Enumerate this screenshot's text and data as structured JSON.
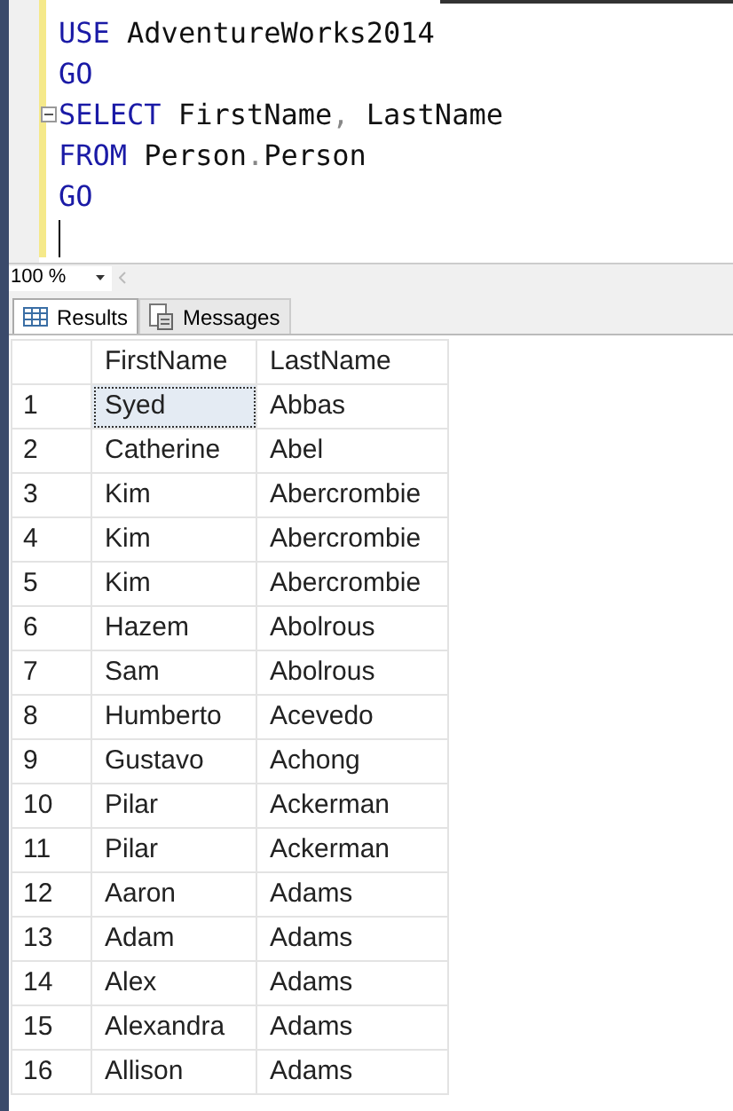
{
  "editor": {
    "lines": [
      {
        "tokens": [
          {
            "text": "USE",
            "kind": "keyword"
          },
          {
            "text": " AdventureWorks2014",
            "kind": "plain"
          }
        ]
      },
      {
        "tokens": [
          {
            "text": "GO",
            "kind": "keyword"
          }
        ]
      },
      {
        "collapsible": true,
        "tokens": [
          {
            "text": "SELECT",
            "kind": "keyword"
          },
          {
            "text": " FirstName",
            "kind": "plain"
          },
          {
            "text": ",",
            "kind": "punct"
          },
          {
            "text": " LastName",
            "kind": "plain"
          }
        ]
      },
      {
        "tokens": [
          {
            "text": "FROM",
            "kind": "keyword"
          },
          {
            "text": " Person",
            "kind": "plain"
          },
          {
            "text": ".",
            "kind": "punct"
          },
          {
            "text": "Person",
            "kind": "plain"
          }
        ]
      },
      {
        "tokens": [
          {
            "text": "GO",
            "kind": "keyword"
          }
        ]
      }
    ]
  },
  "zoom": {
    "value": "100 %"
  },
  "tabs": [
    {
      "label": "Results",
      "selected": true,
      "kind": "grid"
    },
    {
      "label": "Messages",
      "selected": false,
      "kind": "messages"
    }
  ],
  "table": {
    "columns": [
      "FirstName",
      "LastName"
    ],
    "rows": [
      {
        "n": "1",
        "cells": [
          "Syed",
          "Abbas"
        ],
        "selected": true
      },
      {
        "n": "2",
        "cells": [
          "Catherine",
          "Abel"
        ],
        "selected": false
      },
      {
        "n": "3",
        "cells": [
          "Kim",
          "Abercrombie"
        ],
        "selected": false
      },
      {
        "n": "4",
        "cells": [
          "Kim",
          "Abercrombie"
        ],
        "selected": false
      },
      {
        "n": "5",
        "cells": [
          "Kim",
          "Abercrombie"
        ],
        "selected": false
      },
      {
        "n": "6",
        "cells": [
          "Hazem",
          "Abolrous"
        ],
        "selected": false
      },
      {
        "n": "7",
        "cells": [
          "Sam",
          "Abolrous"
        ],
        "selected": false
      },
      {
        "n": "8",
        "cells": [
          "Humberto",
          "Acevedo"
        ],
        "selected": false
      },
      {
        "n": "9",
        "cells": [
          "Gustavo",
          "Achong"
        ],
        "selected": false
      },
      {
        "n": "10",
        "cells": [
          "Pilar",
          "Ackerman"
        ],
        "selected": false
      },
      {
        "n": "11",
        "cells": [
          "Pilar",
          "Ackerman"
        ],
        "selected": false
      },
      {
        "n": "12",
        "cells": [
          "Aaron",
          "Adams"
        ],
        "selected": false
      },
      {
        "n": "13",
        "cells": [
          "Adam",
          "Adams"
        ],
        "selected": false
      },
      {
        "n": "14",
        "cells": [
          "Alex",
          "Adams"
        ],
        "selected": false
      },
      {
        "n": "15",
        "cells": [
          "Alexandra",
          "Adams"
        ],
        "selected": false
      },
      {
        "n": "16",
        "cells": [
          "Allison",
          "Adams"
        ],
        "selected": false
      }
    ]
  }
}
